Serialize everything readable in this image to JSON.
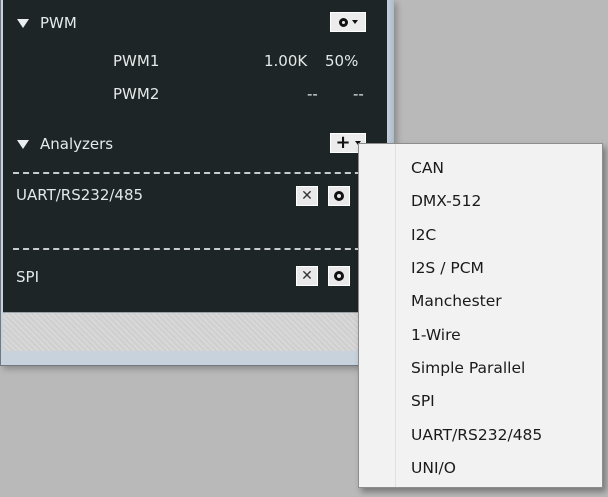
{
  "pwm": {
    "header": "PWM",
    "rows": [
      {
        "name": "PWM1",
        "freq": "1.00K",
        "duty": "50%"
      },
      {
        "name": "PWM2",
        "freq": "--",
        "duty": "--"
      }
    ]
  },
  "analyzers": {
    "header": "Analyzers",
    "items": [
      {
        "name": "UART/RS232/485"
      },
      {
        "name": "SPI"
      }
    ]
  },
  "menu": {
    "items": [
      "CAN",
      "DMX-512",
      "I2C",
      "I2S / PCM",
      "Manchester",
      "1-Wire",
      "Simple Parallel",
      "SPI",
      "UART/RS232/485",
      "UNI/O"
    ]
  },
  "icons": {
    "collapse": "triangle-down-icon",
    "settings": "gear-icon",
    "dropdown": "caret-down-icon",
    "add": "plus-icon",
    "remove": "close-icon"
  }
}
